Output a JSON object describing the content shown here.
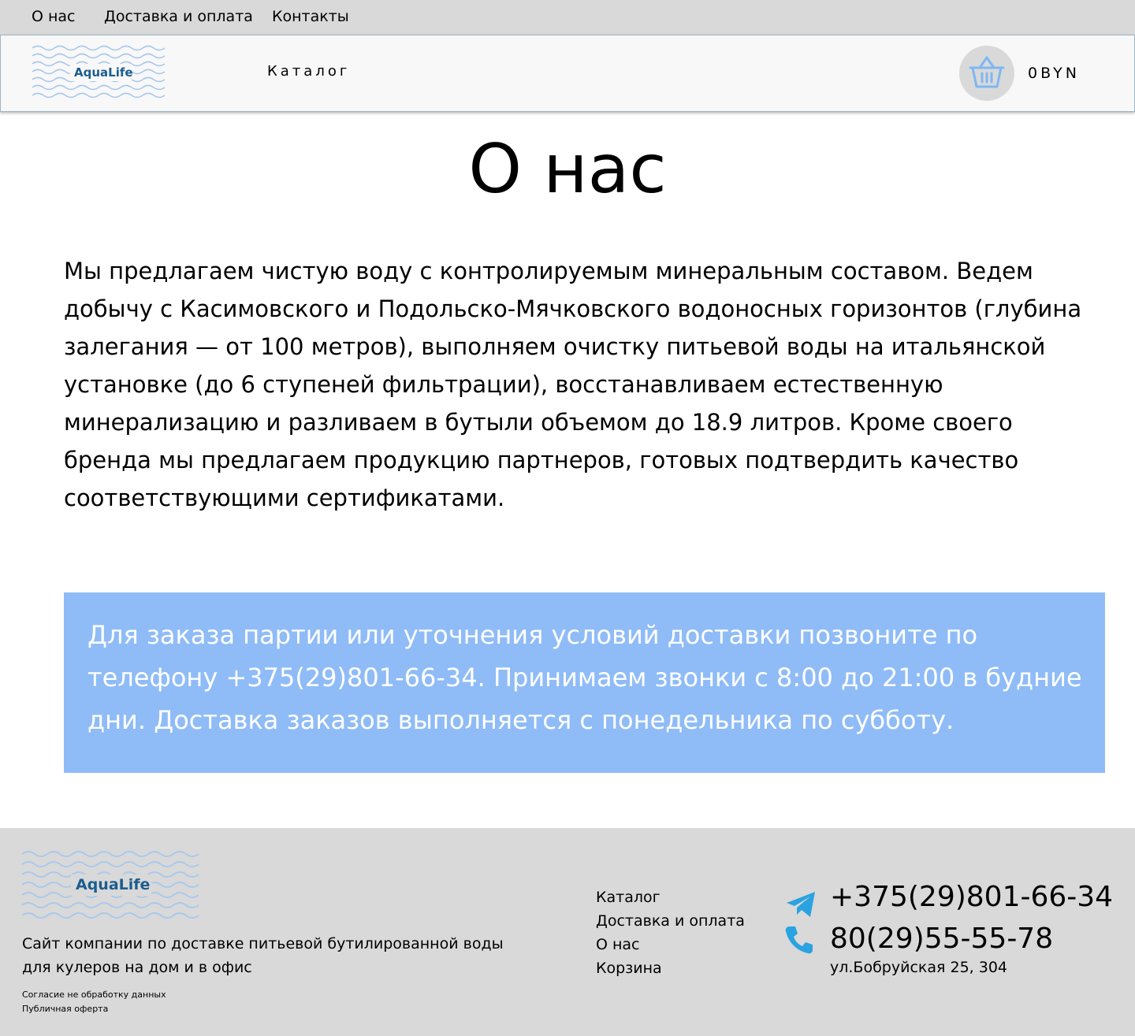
{
  "topnav": {
    "about": "О нас",
    "delivery": "Доставка и оплата",
    "contacts": "Контакты"
  },
  "header": {
    "logo_text": "AquaLife",
    "catalog": "Каталог",
    "cart_total": "0BYN"
  },
  "main": {
    "title": "О нас",
    "about_text": "Мы предлагаем чистую воду с контролируемым минеральным составом. Ведем добычу с Касимовского и Подольско-Мячковского водоносных горизонтов (глубина залегания — от 100 метров), выполняем очистку питьевой воды на итальянской установке (до 6 ступеней фильтрации), восстанавливаем естественную минерализацию и разливаем в бутыли объемом до 18.9 литров. Кроме своего бренда мы предлагаем продукцию партнеров, готовых подтвердить качество соответствующими сертификатами.",
    "notice": "Для заказа партии или уточнения условий доставки позвоните по телефону +375(29)801-66-34. Принимаем звонки с 8:00 до 21:00 в будние дни. Доставка заказов выполняется с понедельника по субботу."
  },
  "footer": {
    "logo_text": "AquaLife",
    "description": "Сайт компании по доставке питьевой бутилированной воды для кулеров на дом и в офис",
    "legal": [
      "Согласие не обработку данных",
      "Публичная оферта"
    ],
    "nav": [
      "Каталог",
      "Доставка и оплата",
      "О нас",
      "Корзина"
    ],
    "phone_telegram": "+375(29)801-66-34",
    "phone": "80(29)55-55-78",
    "address": "ул.Бобруйская 25, 304"
  },
  "colors": {
    "topbar_bg": "#d9d9d9",
    "notice_bg": "#8fbcf7",
    "logo_wave": "#a9c9ec",
    "logo_text": "#1c5d8e",
    "cart_icon": "#7fb7f2",
    "telegram": "#2aa3e0"
  },
  "icons": {
    "cart": "shopping-basket-icon",
    "telegram": "telegram-icon",
    "phone": "phone-icon"
  }
}
